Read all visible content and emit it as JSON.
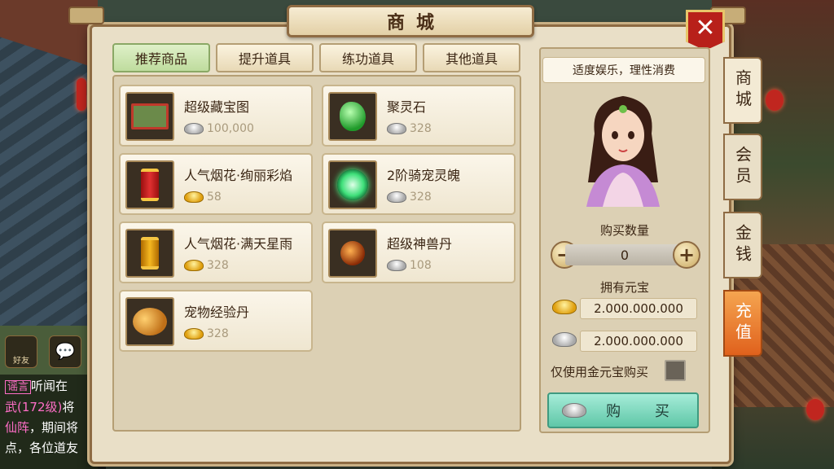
{
  "window": {
    "title": "商城",
    "close_label": "✕"
  },
  "tabs": [
    {
      "label": "推荐商品",
      "active": true
    },
    {
      "label": "提升道具",
      "active": false
    },
    {
      "label": "练功道具",
      "active": false
    },
    {
      "label": "其他道具",
      "active": false
    }
  ],
  "items": [
    {
      "name": "超级藏宝图",
      "price": "100,000",
      "currency": "silver",
      "icon": "treasure-map-icon"
    },
    {
      "name": "聚灵石",
      "price": "328",
      "currency": "silver",
      "icon": "green-stone-icon"
    },
    {
      "name": "人气烟花·绚丽彩焰",
      "price": "58",
      "currency": "gold",
      "icon": "red-firework-icon"
    },
    {
      "name": "2阶骑宠灵魄",
      "price": "328",
      "currency": "silver",
      "icon": "green-orb-icon"
    },
    {
      "name": "人气烟花·满天星雨",
      "price": "328",
      "currency": "gold",
      "icon": "gold-firework-icon"
    },
    {
      "name": "超级神兽丹",
      "price": "108",
      "currency": "silver",
      "icon": "beast-pill-icon"
    },
    {
      "name": "宠物经验丹",
      "price": "328",
      "currency": "gold",
      "icon": "pet-exp-pill-icon"
    }
  ],
  "side": {
    "motto": "适度娱乐，理性消费",
    "quantity_label": "购买数量",
    "quantity_value": "0",
    "minus_label": "−",
    "plus_label": "+",
    "balance_label": "拥有元宝",
    "gold_balance": "2.000.000.000",
    "silver_balance": "2.000.000.000",
    "gold_only_label": "仅使用金元宝购买",
    "gold_only_checked": false,
    "buy_label": "购 买"
  },
  "side_tabs": [
    {
      "label": "商城",
      "active": true
    },
    {
      "label": "会员",
      "active": false
    },
    {
      "label": "金钱",
      "active": false
    },
    {
      "label": "充值",
      "active": false
    }
  ],
  "chat": {
    "friends_label": "好友",
    "lines": [
      {
        "tag": "谣言",
        "text": "听闻在"
      },
      {
        "pink": "武",
        "level": "(172级)",
        "text": "将"
      },
      {
        "pink": "仙阵",
        "text": "，期间将"
      },
      {
        "text": "点，各位道友"
      }
    ]
  },
  "colors": {
    "panel_bg": "#e9dfc7",
    "accent_green": "#bfdc9e",
    "buy_button": "#5fc7a8",
    "recharge_tab": "#e0611c",
    "close_button": "#b8201a"
  }
}
